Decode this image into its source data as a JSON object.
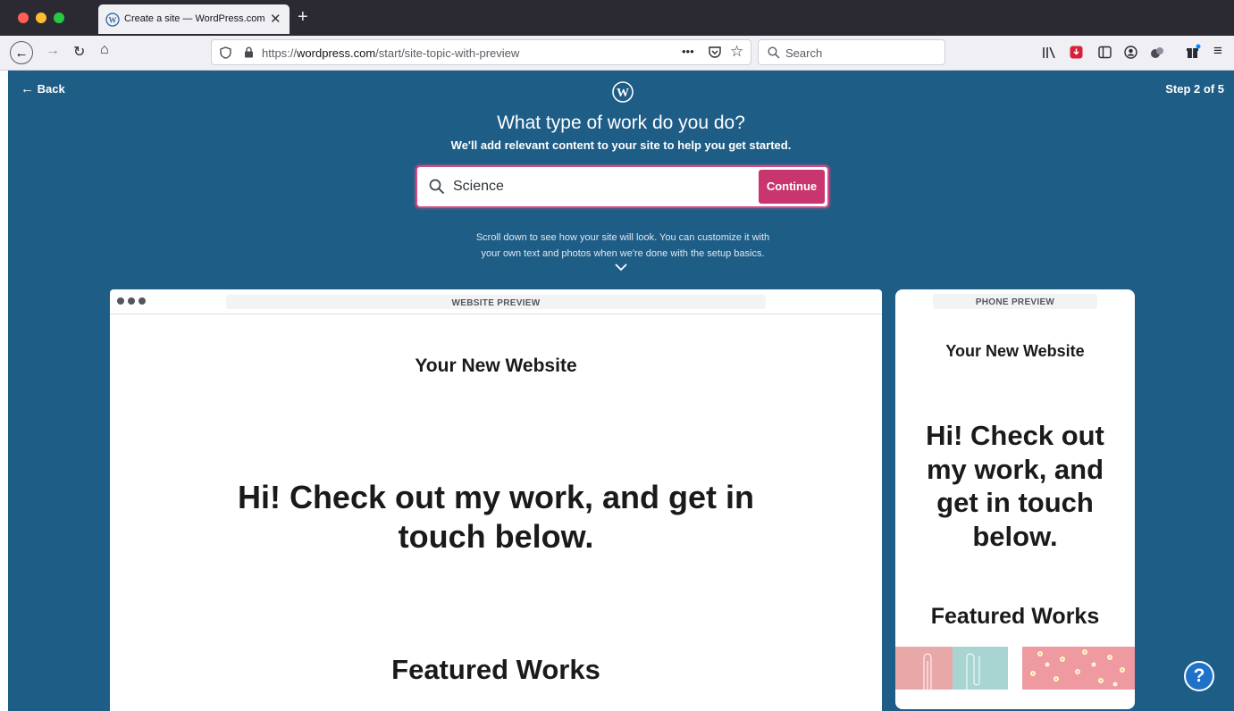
{
  "browser": {
    "tab_title": "Create a site — WordPress.com",
    "tab_close": "✕",
    "new_tab": "+",
    "url_prefix": "https://",
    "url_domain": "wordpress.com",
    "url_path": "/start/site-topic-with-preview",
    "search_placeholder": "Search",
    "page_actions": "•••"
  },
  "signup": {
    "back_label": "Back",
    "step_label": "Step 2 of 5",
    "heading": "What type of work do you do?",
    "subheading": "We'll add relevant content to your site to help you get started.",
    "topic_value": "Science",
    "continue_label": "Continue",
    "hint_line1": "Scroll down to see how your site will look. You can customize it with",
    "hint_line2": "your own text and photos when we're done with the setup basics."
  },
  "web_preview": {
    "label": "WEBSITE PREVIEW",
    "site_title": "Your New Website",
    "headline": "Hi! Check out my work, and get in touch below.",
    "featured": "Featured Works"
  },
  "phone_preview": {
    "label": "PHONE PREVIEW",
    "site_title": "Your New Website",
    "headline": "Hi! Check out my work, and get in touch below.",
    "featured": "Featured Works"
  },
  "help": {
    "label": "?"
  },
  "colors": {
    "background": "#1e5d86",
    "accent": "#c9356e",
    "help": "#1e73c8"
  }
}
